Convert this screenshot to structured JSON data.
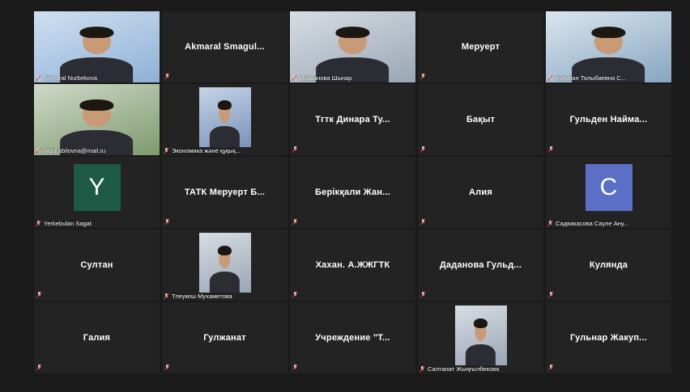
{
  "meeting": {
    "tiles": [
      {
        "name": "Akmaral Nurbekova",
        "video": true,
        "label": true
      },
      {
        "name": "Akmaral  Smagul...",
        "video": false
      },
      {
        "name": "Исаханова Шынар",
        "video": true,
        "label": true,
        "active": true
      },
      {
        "name": "Меруерт",
        "video": false
      },
      {
        "name": "Кульпан Толыбаевна С...",
        "video": true,
        "label": true
      },
      {
        "name": "aigul.abilovna@mail.ru",
        "video": true,
        "label": true
      },
      {
        "name": "Экономика және құқық...",
        "video": true,
        "label": true,
        "small": true
      },
      {
        "name": "Тгтк Динара Ту...",
        "video": false
      },
      {
        "name": "Бақыт",
        "video": false
      },
      {
        "name": "Гульден  Найма...",
        "video": false
      },
      {
        "name": "Yerkebulan Sagat",
        "video": false,
        "label": true,
        "avatar": "Y",
        "avatar_color": "#1e5a46"
      },
      {
        "name": "ТАТК Меруерт Б...",
        "video": false
      },
      {
        "name": "Берікқали Жан...",
        "video": false
      },
      {
        "name": "Алия",
        "video": false
      },
      {
        "name": "Садвакасова Сауле Ану...",
        "video": false,
        "label": true,
        "avatar": "C",
        "avatar_color": "#5b6fc7"
      },
      {
        "name": "Султан",
        "video": false
      },
      {
        "name": "Тлеукеш Мухаметова",
        "video": true,
        "label": true,
        "small": true
      },
      {
        "name": "Хахан. А.ЖЖГТК",
        "video": false
      },
      {
        "name": "Даданова  Гульд...",
        "video": false
      },
      {
        "name": "Кулянда",
        "video": false
      },
      {
        "name": "Галия",
        "video": false
      },
      {
        "name": "Гулжанат",
        "video": false
      },
      {
        "name": "Учреждение \"Т...",
        "video": false
      },
      {
        "name": "Салтанат Жыңғылбекова",
        "video": true,
        "label": true,
        "small": true
      },
      {
        "name": "Гульнар  Жакуп...",
        "video": false
      }
    ]
  }
}
